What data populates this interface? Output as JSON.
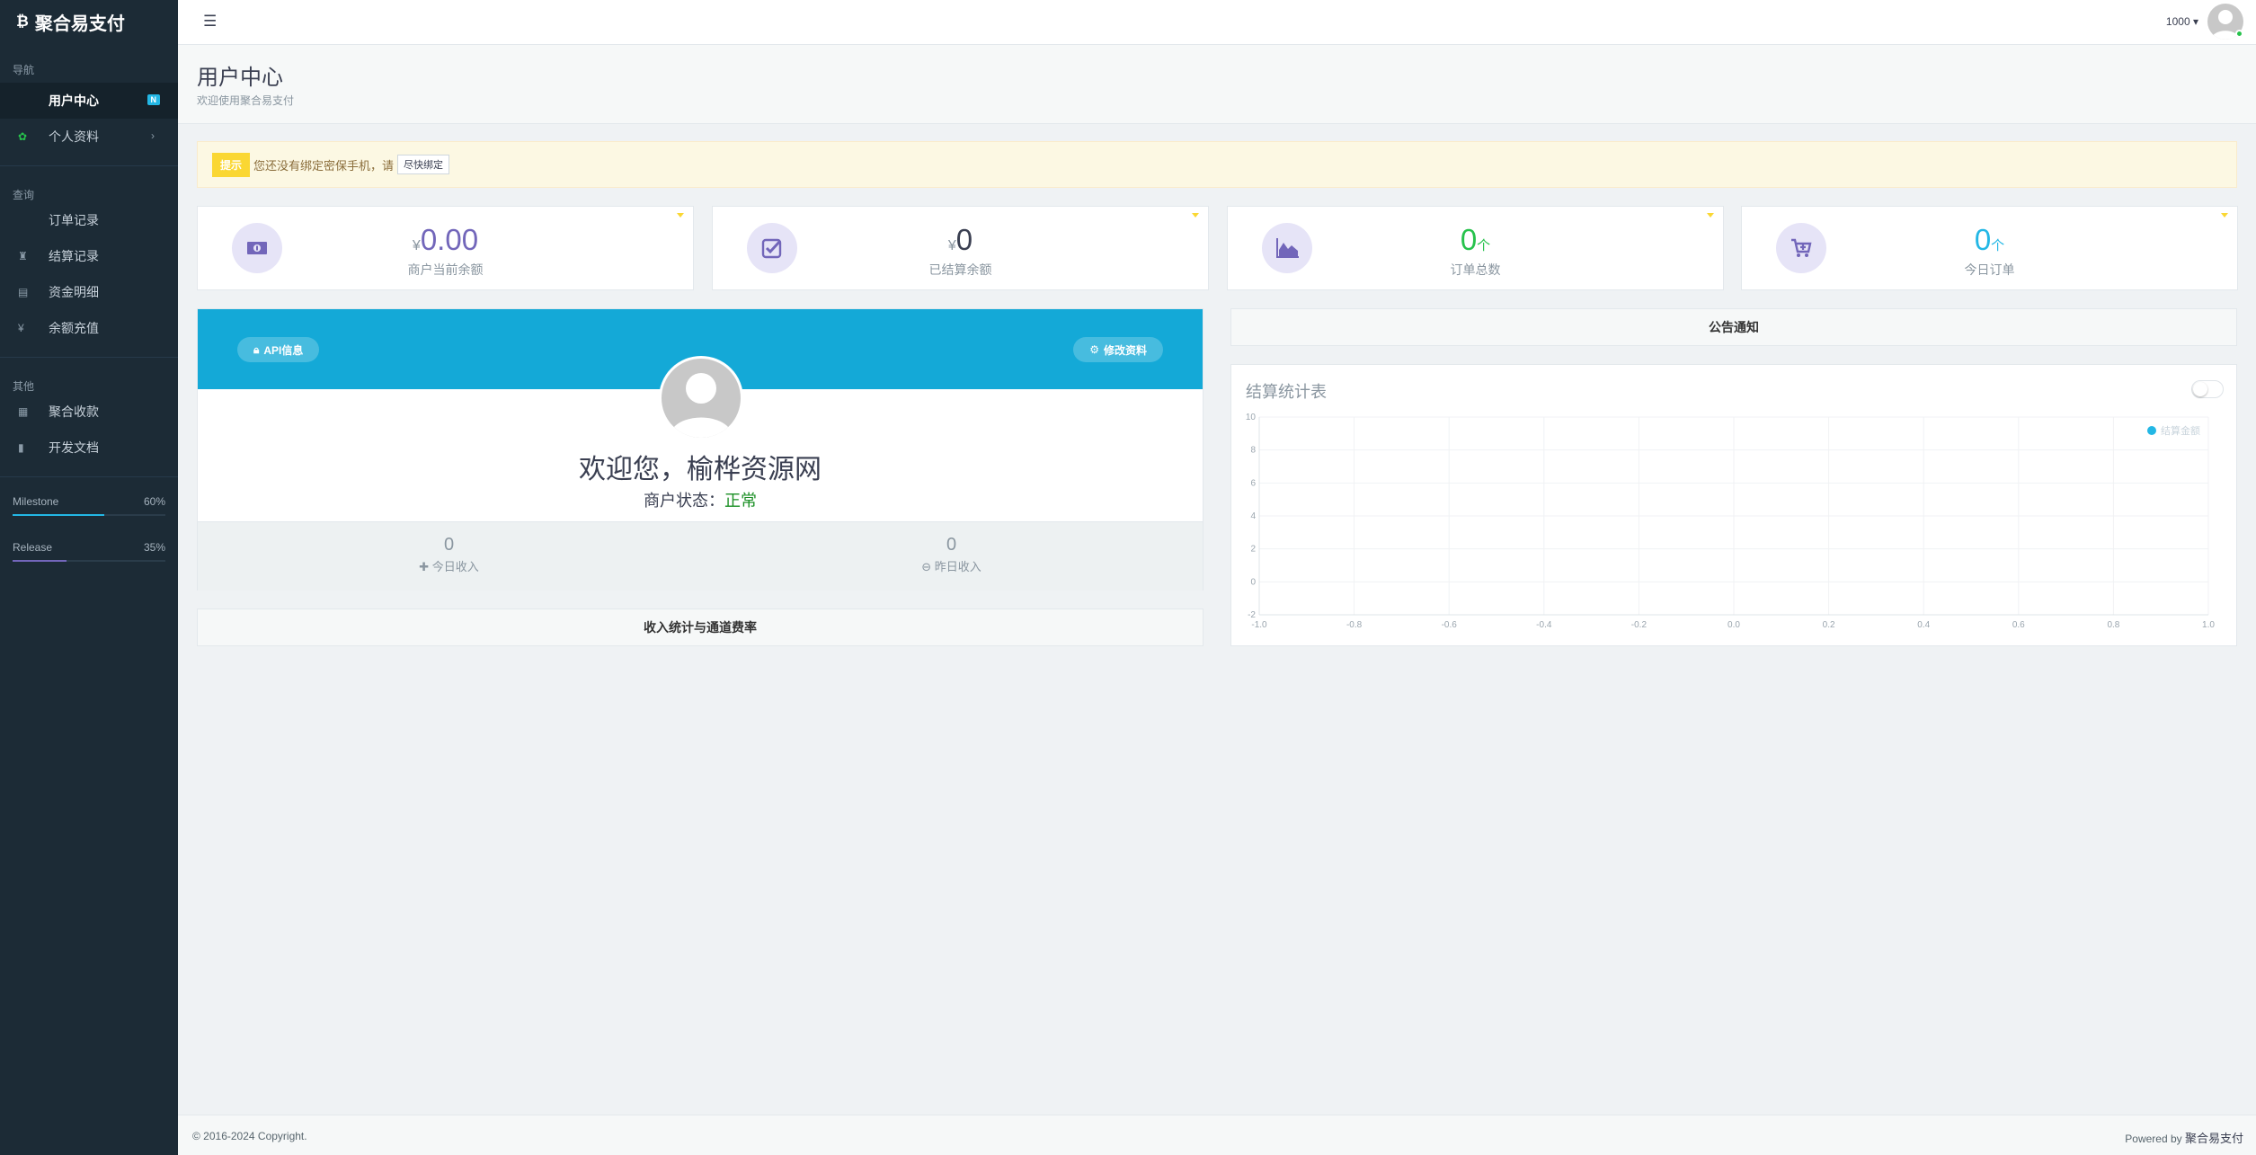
{
  "brand": {
    "name": "聚合易支付",
    "icon": "bitcoin-icon"
  },
  "sidebar": {
    "sections": [
      {
        "label": "导航"
      },
      {
        "label": "查询"
      },
      {
        "label": "其他"
      }
    ],
    "nav": [
      {
        "label": "用户中心",
        "badge": "N",
        "icon": "none"
      },
      {
        "label": "个人资料",
        "icon": "user-icon"
      }
    ],
    "query": [
      {
        "label": "订单记录",
        "icon": "list-icon"
      },
      {
        "label": "结算记录",
        "icon": "settle-icon"
      },
      {
        "label": "资金明细",
        "icon": "fund-icon"
      },
      {
        "label": "余额充值",
        "icon": "yen-icon"
      }
    ],
    "other": [
      {
        "label": "聚合收款",
        "icon": "qrcode-icon"
      },
      {
        "label": "开发文档",
        "icon": "book-icon"
      }
    ],
    "progress": [
      {
        "label": "Milestone",
        "value": "60%",
        "fraction": 0.6,
        "color": "#23b7e5"
      },
      {
        "label": "Release",
        "value": "35%",
        "fraction": 0.35,
        "color": "#7266ba"
      }
    ]
  },
  "header": {
    "user_id": "1000",
    "caret": "▾"
  },
  "page": {
    "title": "用户中心",
    "subtitle": "欢迎使用聚合易支付"
  },
  "alert": {
    "tag": "提示",
    "text": "您还没有绑定密保手机，请",
    "button": "尽快绑定"
  },
  "stats": [
    {
      "currency": "¥",
      "value": "0.00",
      "unit": "",
      "label": "商户当前余额",
      "color": "#7266ba",
      "icon": "money-icon"
    },
    {
      "currency": "¥",
      "value": "0",
      "unit": "",
      "label": "已结算余额",
      "color": "#3a3f51",
      "icon": "check-square-icon"
    },
    {
      "currency": "",
      "value": "0",
      "unit": "个",
      "label": "订单总数",
      "color": "#27c24c",
      "icon": "area-chart-icon"
    },
    {
      "currency": "",
      "value": "0",
      "unit": "个",
      "label": "今日订单",
      "color": "#23b7e5",
      "icon": "cart-plus-icon"
    }
  ],
  "profile": {
    "api_button": "API信息",
    "edit_button": "修改资料",
    "welcome": "欢迎您，榆桦资源网",
    "status_label": "商户状态：",
    "status_value": "正常",
    "today_income": {
      "value": "0",
      "label": "今日收入"
    },
    "yesterday_income": {
      "value": "0",
      "label": "昨日收入"
    }
  },
  "panels": {
    "income_stats": "收入统计与通道费率",
    "announcement": "公告通知",
    "chart_title": "结算统计表"
  },
  "chart_data": {
    "type": "line",
    "title": "结算统计表",
    "series": [
      {
        "name": "结算金额",
        "values": []
      }
    ],
    "x": [],
    "xlim": [
      -1.0,
      1.0
    ],
    "ylim": [
      -2,
      10
    ],
    "x_ticks": [
      "-1.0",
      "-0.8",
      "-0.6",
      "-0.4",
      "-0.2",
      "0.0",
      "0.2",
      "0.4",
      "0.6",
      "0.8",
      "1.0"
    ],
    "y_ticks": [
      "10",
      "8",
      "6",
      "4",
      "2",
      "0",
      "-2"
    ],
    "grid": true,
    "legend": "top-right",
    "series_color": "#23b7e5"
  },
  "footer": {
    "copyright": "© 2016-2024 Copyright.",
    "powered_prefix": "Powered by",
    "powered_name": "聚合易支付"
  }
}
